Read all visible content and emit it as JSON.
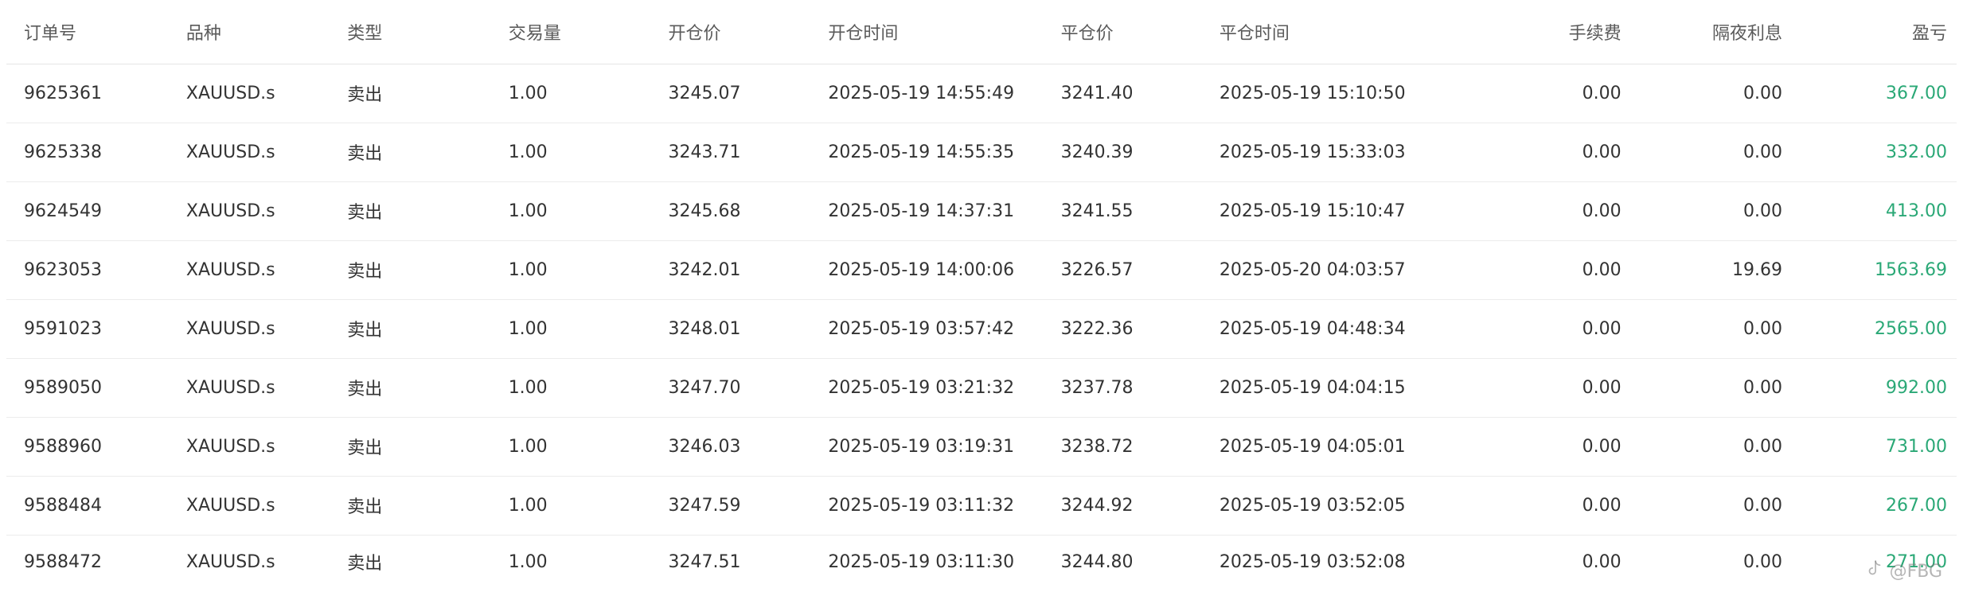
{
  "table": {
    "headers": [
      "订单号",
      "品种",
      "类型",
      "交易量",
      "开仓价",
      "开仓时间",
      "平仓价",
      "平仓时间",
      "手续费",
      "隔夜利息",
      "盈亏"
    ],
    "rows": [
      {
        "order": "9625361",
        "symbol": "XAUUSD.s",
        "type": "卖出",
        "volume": "1.00",
        "open_price": "3245.07",
        "open_time": "2025-05-19 14:55:49",
        "close_price": "3241.40",
        "close_time": "2025-05-19 15:10:50",
        "fee": "0.00",
        "swap": "0.00",
        "pnl": "367.00"
      },
      {
        "order": "9625338",
        "symbol": "XAUUSD.s",
        "type": "卖出",
        "volume": "1.00",
        "open_price": "3243.71",
        "open_time": "2025-05-19 14:55:35",
        "close_price": "3240.39",
        "close_time": "2025-05-19 15:33:03",
        "fee": "0.00",
        "swap": "0.00",
        "pnl": "332.00"
      },
      {
        "order": "9624549",
        "symbol": "XAUUSD.s",
        "type": "卖出",
        "volume": "1.00",
        "open_price": "3245.68",
        "open_time": "2025-05-19 14:37:31",
        "close_price": "3241.55",
        "close_time": "2025-05-19 15:10:47",
        "fee": "0.00",
        "swap": "0.00",
        "pnl": "413.00"
      },
      {
        "order": "9623053",
        "symbol": "XAUUSD.s",
        "type": "卖出",
        "volume": "1.00",
        "open_price": "3242.01",
        "open_time": "2025-05-19 14:00:06",
        "close_price": "3226.57",
        "close_time": "2025-05-20 04:03:57",
        "fee": "0.00",
        "swap": "19.69",
        "pnl": "1563.69"
      },
      {
        "order": "9591023",
        "symbol": "XAUUSD.s",
        "type": "卖出",
        "volume": "1.00",
        "open_price": "3248.01",
        "open_time": "2025-05-19 03:57:42",
        "close_price": "3222.36",
        "close_time": "2025-05-19 04:48:34",
        "fee": "0.00",
        "swap": "0.00",
        "pnl": "2565.00"
      },
      {
        "order": "9589050",
        "symbol": "XAUUSD.s",
        "type": "卖出",
        "volume": "1.00",
        "open_price": "3247.70",
        "open_time": "2025-05-19 03:21:32",
        "close_price": "3237.78",
        "close_time": "2025-05-19 04:04:15",
        "fee": "0.00",
        "swap": "0.00",
        "pnl": "992.00"
      },
      {
        "order": "9588960",
        "symbol": "XAUUSD.s",
        "type": "卖出",
        "volume": "1.00",
        "open_price": "3246.03",
        "open_time": "2025-05-19 03:19:31",
        "close_price": "3238.72",
        "close_time": "2025-05-19 04:05:01",
        "fee": "0.00",
        "swap": "0.00",
        "pnl": "731.00"
      },
      {
        "order": "9588484",
        "symbol": "XAUUSD.s",
        "type": "卖出",
        "volume": "1.00",
        "open_price": "3247.59",
        "open_time": "2025-05-19 03:11:32",
        "close_price": "3244.92",
        "close_time": "2025-05-19 03:52:05",
        "fee": "0.00",
        "swap": "0.00",
        "pnl": "267.00"
      },
      {
        "order": "9588472",
        "symbol": "XAUUSD.s",
        "type": "卖出",
        "volume": "1.00",
        "open_price": "3247.51",
        "open_time": "2025-05-19 03:11:30",
        "close_price": "3244.80",
        "close_time": "2025-05-19 03:52:08",
        "fee": "0.00",
        "swap": "0.00",
        "pnl": "271.00"
      }
    ]
  },
  "colors": {
    "profit": "#2aa876",
    "header_text": "#5a5a5a",
    "row_border": "#ececec"
  },
  "watermark": {
    "icon": "tiktok-logo-icon",
    "text": "@FBG"
  }
}
